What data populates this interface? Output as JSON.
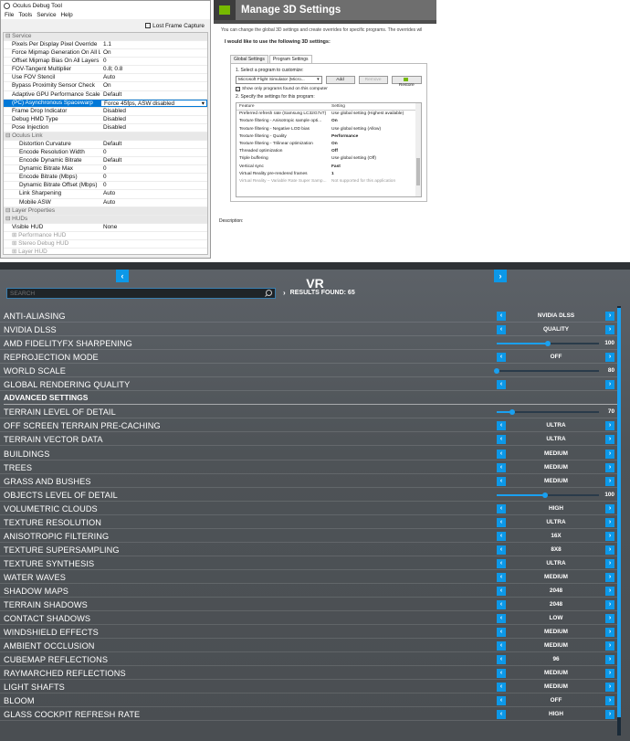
{
  "oculus": {
    "title": "Oculus Debug Tool",
    "menu": [
      "File",
      "Tools",
      "Service",
      "Help"
    ],
    "lost_frame_capture": "Lost Frame Capture",
    "rows": [
      {
        "type": "cat",
        "k": "Service",
        "v": ""
      },
      {
        "type": "row",
        "k": "Pixels Per Display Pixel Override",
        "v": "1.1"
      },
      {
        "type": "row",
        "k": "Force Mipmap Generation On All Layers",
        "v": "On"
      },
      {
        "type": "row",
        "k": "Offset Mipmap Bias On All Layers",
        "v": "0"
      },
      {
        "type": "row",
        "k": "FOV-Tangent Multiplier",
        "v": "0.8; 0.8"
      },
      {
        "type": "row",
        "k": "Use FOV Stencil",
        "v": "Auto"
      },
      {
        "type": "row",
        "k": "Bypass Proximity Sensor Check",
        "v": "On"
      },
      {
        "type": "row",
        "k": "Adaptive GPU Performance Scale",
        "v": "Default"
      },
      {
        "type": "sel",
        "k": "(PC) Asynchronous Spacewarp",
        "v": "Force 45fps, ASW disabled"
      },
      {
        "type": "row",
        "k": "Frame Drop Indicator",
        "v": "Disabled"
      },
      {
        "type": "row",
        "k": "Debug HMD Type",
        "v": "Disabled"
      },
      {
        "type": "row",
        "k": "Pose Injection",
        "v": "Disabled"
      },
      {
        "type": "cat",
        "k": "Oculus Link",
        "v": ""
      },
      {
        "type": "sub",
        "k": "Distortion Curvature",
        "v": "Default"
      },
      {
        "type": "sub",
        "k": "Encode Resolution Width",
        "v": "0"
      },
      {
        "type": "sub",
        "k": "Encode Dynamic Bitrate",
        "v": "Default"
      },
      {
        "type": "sub",
        "k": "Dynamic Bitrate Max",
        "v": "0"
      },
      {
        "type": "sub",
        "k": "Encode Bitrate (Mbps)",
        "v": "0"
      },
      {
        "type": "sub",
        "k": "Dynamic Bitrate Offset (Mbps)",
        "v": "0"
      },
      {
        "type": "sub",
        "k": "Link Sharpening",
        "v": "Auto"
      },
      {
        "type": "sub",
        "k": "Mobile ASW",
        "v": "Auto"
      },
      {
        "type": "cat",
        "k": "Layer Properties",
        "v": ""
      },
      {
        "type": "cat",
        "k": "HUDs",
        "v": ""
      },
      {
        "type": "row",
        "k": "Visible HUD",
        "v": "None"
      },
      {
        "type": "grp",
        "k": "Performance HUD",
        "v": ""
      },
      {
        "type": "grp",
        "k": "Stereo Debug HUD",
        "v": ""
      },
      {
        "type": "grp",
        "k": "Layer HUD",
        "v": ""
      }
    ]
  },
  "nvidia": {
    "title": "Manage 3D Settings",
    "intro": "You can change the global 3D settings and create overrides for specific programs. The overrides wil",
    "question": "I would like to use the following 3D settings:",
    "tabs": [
      "Global Settings",
      "Program Settings"
    ],
    "step1": "1. Select a program to customize:",
    "program": "Microsoft Flight Simulator (Micro...",
    "add": "Add",
    "remove": "Remove",
    "restore": "Restore",
    "show_only": "Show only programs found on this computer",
    "step2": "2. Specify the settings for this program:",
    "col_feature": "Feature",
    "col_setting": "Setting",
    "features": [
      {
        "f": "Preferred refresh rate (Samsung LC32G7xT)",
        "s": "Use global setting (Highest available)",
        "b": false
      },
      {
        "f": "Texture filtering - Anisotropic sample opti...",
        "s": "On",
        "b": true
      },
      {
        "f": "Texture filtering - Negative LOD bias",
        "s": "Use global setting (Allow)",
        "b": false
      },
      {
        "f": "Texture filtering - Quality",
        "s": "Performance",
        "b": true
      },
      {
        "f": "Texture filtering - Trilinear optimization",
        "s": "On",
        "b": true
      },
      {
        "f": "Threaded optimization",
        "s": "Off",
        "b": true
      },
      {
        "f": "Triple buffering",
        "s": "Use global setting (Off)",
        "b": false
      },
      {
        "f": "Vertical sync",
        "s": "Fast",
        "b": true
      },
      {
        "f": "Virtual Reality pre-rendered frames",
        "s": "1",
        "b": true
      },
      {
        "f": "Virtual Reality – Variable Rate Super Samp...",
        "s": "Not supported for this application",
        "b": false,
        "na": true
      }
    ],
    "description": "Description:"
  },
  "msfs": {
    "page_title": "VR",
    "search_placeholder": "SEARCH",
    "results_label": "RESULTS FOUND: 65",
    "settings": [
      {
        "label": "ANTI-ALIASING",
        "kind": "choice",
        "value": "NVIDIA DLSS"
      },
      {
        "label": "NVIDIA DLSS",
        "kind": "choice",
        "value": "QUALITY"
      },
      {
        "label": "AMD FIDELITYFX SHARPENING",
        "kind": "slider",
        "value": 100,
        "max": 200
      },
      {
        "label": "REPROJECTION MODE",
        "kind": "choice",
        "value": "OFF"
      },
      {
        "label": "WORLD SCALE",
        "kind": "slider",
        "value": 80,
        "min": 80,
        "max": 120
      },
      {
        "label": "GLOBAL RENDERING QUALITY",
        "kind": "choice",
        "value": ""
      },
      {
        "label": "ADVANCED SETTINGS",
        "kind": "section"
      },
      {
        "label": "TERRAIN LEVEL OF DETAIL",
        "kind": "slider",
        "value": 70,
        "min": 10,
        "max": 400
      },
      {
        "label": "OFF SCREEN TERRAIN PRE-CACHING",
        "kind": "choice",
        "value": "ULTRA"
      },
      {
        "label": "TERRAIN VECTOR DATA",
        "kind": "choice",
        "value": "ULTRA"
      },
      {
        "label": "BUILDINGS",
        "kind": "choice",
        "value": "MEDIUM"
      },
      {
        "label": "TREES",
        "kind": "choice",
        "value": "MEDIUM"
      },
      {
        "label": "GRASS AND BUSHES",
        "kind": "choice",
        "value": "MEDIUM"
      },
      {
        "label": "OBJECTS LEVEL OF DETAIL",
        "kind": "slider",
        "value": 100,
        "min": 10,
        "max": 200
      },
      {
        "label": "VOLUMETRIC CLOUDS",
        "kind": "choice",
        "value": "HIGH"
      },
      {
        "label": "TEXTURE RESOLUTION",
        "kind": "choice",
        "value": "ULTRA"
      },
      {
        "label": "ANISOTROPIC FILTERING",
        "kind": "choice",
        "value": "16X"
      },
      {
        "label": "TEXTURE SUPERSAMPLING",
        "kind": "choice",
        "value": "8X8"
      },
      {
        "label": "TEXTURE SYNTHESIS",
        "kind": "choice",
        "value": "ULTRA"
      },
      {
        "label": "WATER WAVES",
        "kind": "choice",
        "value": "MEDIUM"
      },
      {
        "label": "SHADOW MAPS",
        "kind": "choice",
        "value": "2048"
      },
      {
        "label": "TERRAIN SHADOWS",
        "kind": "choice",
        "value": "2048"
      },
      {
        "label": "CONTACT SHADOWS",
        "kind": "choice",
        "value": "LOW"
      },
      {
        "label": "WINDSHIELD EFFECTS",
        "kind": "choice",
        "value": "MEDIUM"
      },
      {
        "label": "AMBIENT OCCLUSION",
        "kind": "choice",
        "value": "MEDIUM"
      },
      {
        "label": "CUBEMAP REFLECTIONS",
        "kind": "choice",
        "value": "96"
      },
      {
        "label": "RAYMARCHED REFLECTIONS",
        "kind": "choice",
        "value": "MEDIUM"
      },
      {
        "label": "LIGHT SHAFTS",
        "kind": "choice",
        "value": "MEDIUM"
      },
      {
        "label": "BLOOM",
        "kind": "choice",
        "value": "OFF"
      },
      {
        "label": "GLASS COCKPIT REFRESH RATE",
        "kind": "choice",
        "value": "HIGH"
      }
    ],
    "accent": "#0c98e8"
  }
}
